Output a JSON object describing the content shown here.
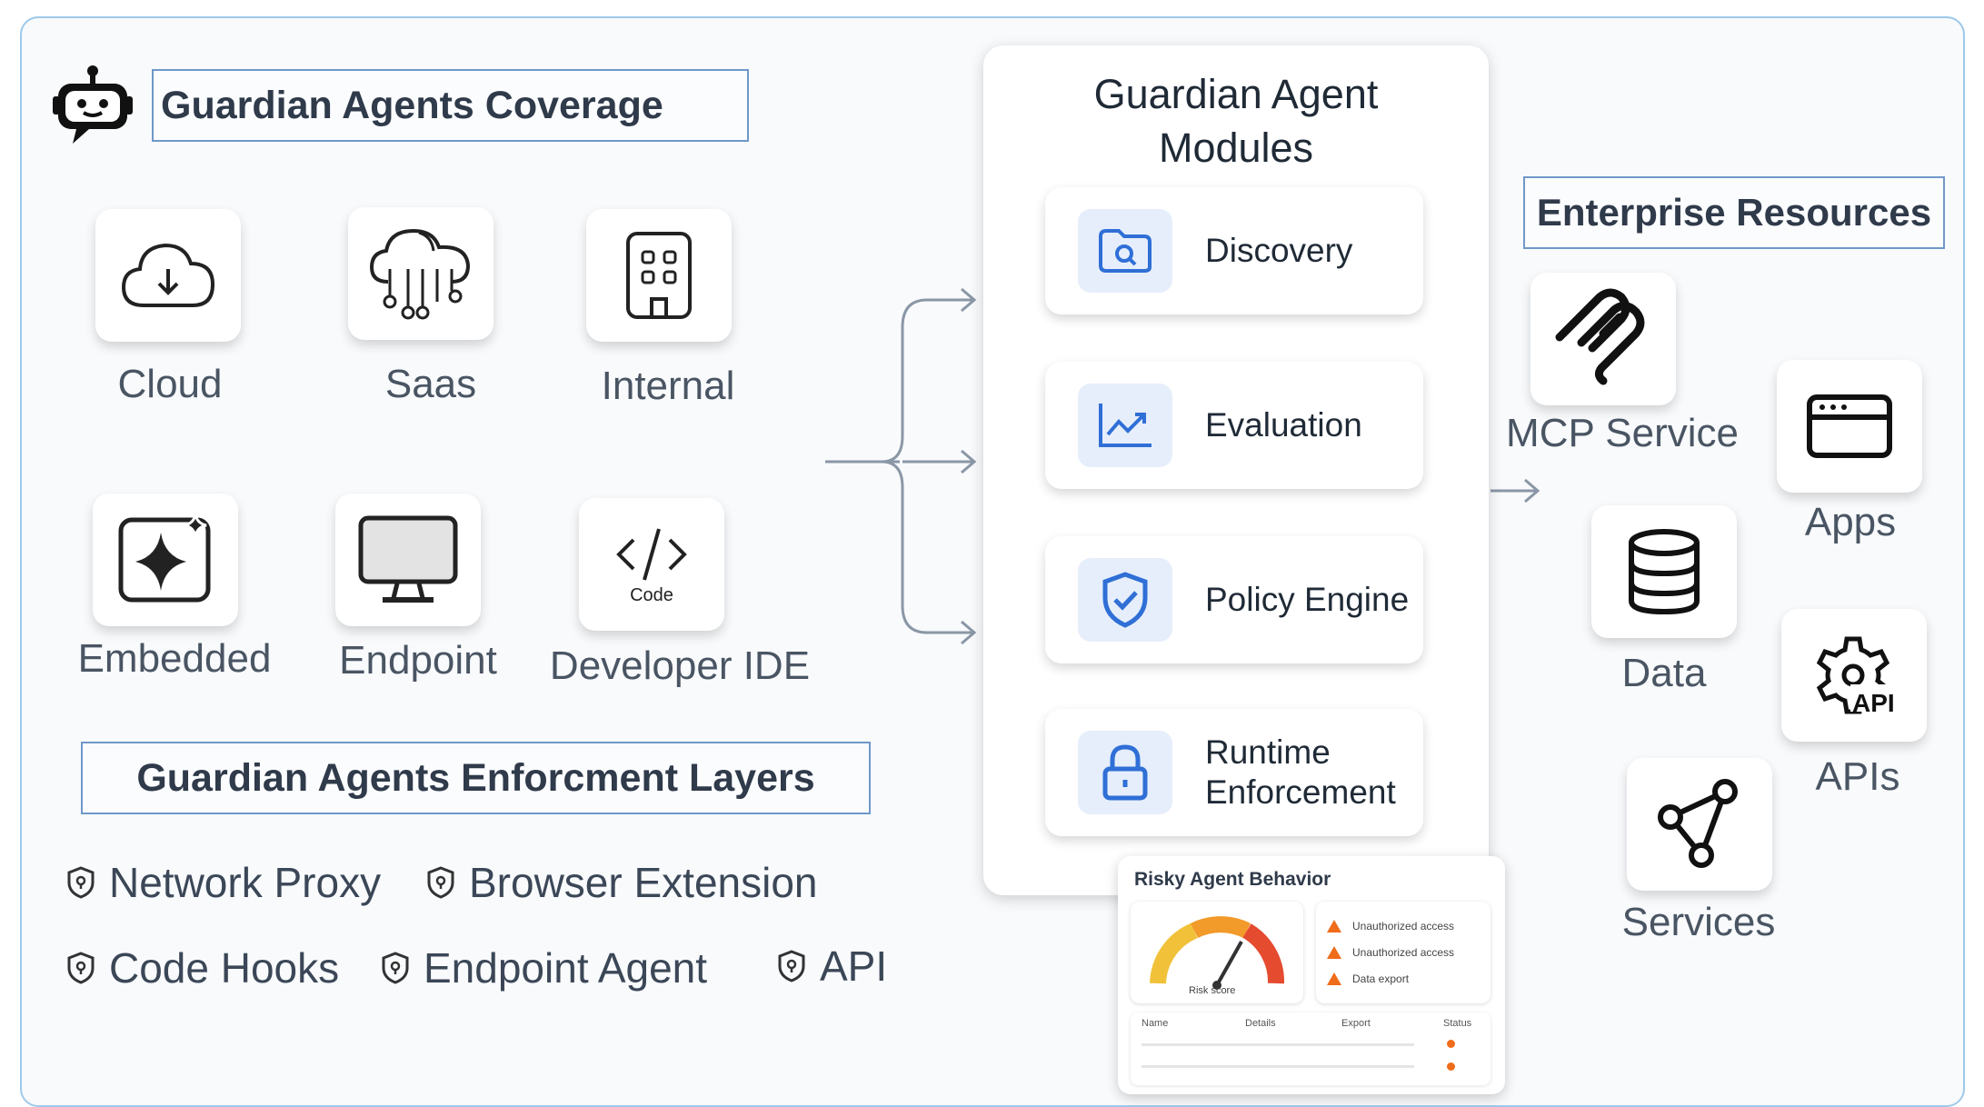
{
  "coverage": {
    "title": "Guardian Agents Coverage",
    "icon": "robot-chat-icon",
    "items": [
      {
        "label": "Cloud",
        "icon": "cloud-download-icon"
      },
      {
        "label": "Saas",
        "icon": "cloud-network-icon"
      },
      {
        "label": "Internal",
        "icon": "building-icon"
      },
      {
        "label": "Embedded",
        "icon": "sparkle-icon"
      },
      {
        "label": "Endpoint",
        "icon": "monitor-icon"
      },
      {
        "label": "Developer IDE",
        "icon": "code-icon",
        "icon_text": "Code"
      }
    ]
  },
  "layers": {
    "title": "Guardian Agents Enforcment Layers",
    "items": [
      "Network Proxy",
      "Browser Extension",
      "Code Hooks",
      "Endpoint Agent",
      "API"
    ]
  },
  "modules": {
    "title_line1": "Guardian Agent",
    "title_line2": "Modules",
    "items": [
      {
        "label": "Discovery",
        "icon": "folder-search-icon"
      },
      {
        "label": "Evaluation",
        "icon": "trend-chart-icon"
      },
      {
        "label": "Policy Engine",
        "icon": "shield-check-icon"
      },
      {
        "label_line1": "Runtime",
        "label_line2": "Enforcement",
        "icon": "lock-icon"
      }
    ]
  },
  "risk": {
    "title": "Risky Agent Behavior",
    "gauge_label": "Risk score",
    "alerts": [
      "Unauthorized access",
      "Unauthorized access",
      "Data export"
    ],
    "columns": [
      "Name",
      "Details",
      "Export",
      "Status"
    ]
  },
  "resources": {
    "title": "Enterprise Resources",
    "items": [
      {
        "label": "MCP Service",
        "icon": "mcp-icon"
      },
      {
        "label": "Apps",
        "icon": "browser-window-icon"
      },
      {
        "label": "Data",
        "icon": "database-icon"
      },
      {
        "label": "APIs",
        "icon": "api-gear-icon",
        "icon_text": "API"
      },
      {
        "label": "Services",
        "icon": "share-nodes-icon"
      }
    ]
  },
  "colors": {
    "accent_blue": "#2f6fd6",
    "frame_border": "#9ec9ea",
    "title_border": "#6f98c8",
    "warning_orange": "#ef6c1a"
  }
}
